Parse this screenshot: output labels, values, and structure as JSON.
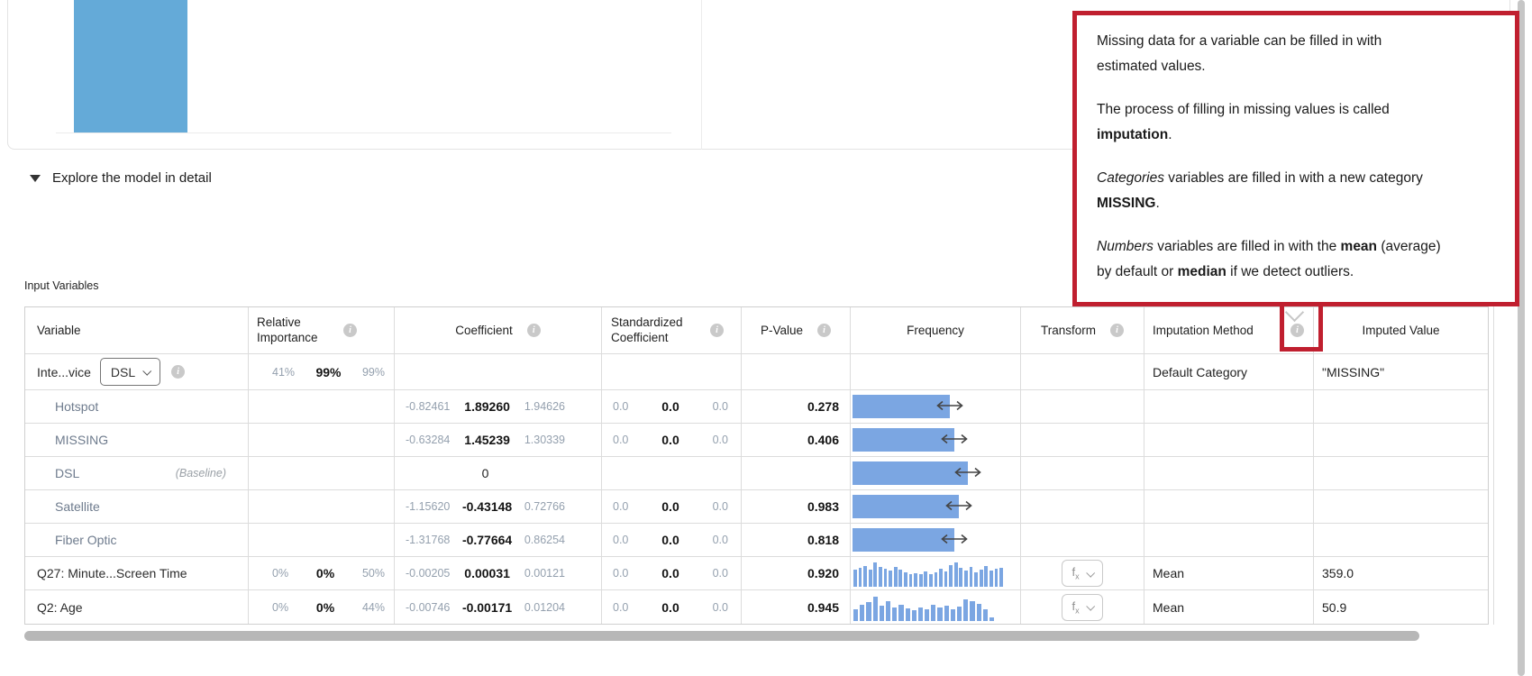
{
  "colors": {
    "chart_bar": "#64aad8",
    "freq_bar": "#7ba6e2",
    "annotation_red": "#c01f2f"
  },
  "explore": {
    "label": "Explore the model in detail"
  },
  "table": {
    "section_label": "Input Variables",
    "columns": [
      {
        "key": "variable",
        "label": "Variable",
        "info": false
      },
      {
        "key": "rel",
        "label": "Relative Importance",
        "info": true
      },
      {
        "key": "coef",
        "label": "Coefficient",
        "info": true
      },
      {
        "key": "std",
        "label": "Standardized Coefficient",
        "info": true
      },
      {
        "key": "pval",
        "label": "P-Value",
        "info": true
      },
      {
        "key": "freq",
        "label": "Frequency",
        "info": false
      },
      {
        "key": "transform",
        "label": "Transform",
        "info": true
      },
      {
        "key": "imp_method",
        "label": "Imputation Method",
        "info": true
      },
      {
        "key": "imp_value",
        "label": "Imputed Value",
        "info": false
      }
    ],
    "rows": [
      {
        "type": "parent",
        "label": "Inte...vice",
        "dropdown_value": "DSL",
        "rel": [
          "41%",
          "99%",
          "99%"
        ],
        "imp_method": "Default Category",
        "imp_value": "\"MISSING\""
      },
      {
        "type": "category",
        "label": "Hotspot",
        "coef": [
          "-0.82461",
          "1.89260",
          "1.94626"
        ],
        "std": [
          "0.0",
          "0.0",
          "0.0"
        ],
        "pval": "0.278",
        "bar": 108
      },
      {
        "type": "category",
        "label": "MISSING",
        "coef": [
          "-0.63284",
          "1.45239",
          "1.30339"
        ],
        "std": [
          "0.0",
          "0.0",
          "0.0"
        ],
        "pval": "0.406",
        "bar": 113
      },
      {
        "type": "category",
        "label": "DSL",
        "note": "(Baseline)",
        "coef_single": "0",
        "bar": 128
      },
      {
        "type": "category",
        "label": "Satellite",
        "coef": [
          "-1.15620",
          "-0.43148",
          "0.72766"
        ],
        "std": [
          "0.0",
          "0.0",
          "0.0"
        ],
        "pval": "0.983",
        "bar": 118
      },
      {
        "type": "category",
        "label": "Fiber Optic",
        "coef": [
          "-1.31768",
          "-0.77664",
          "0.86254"
        ],
        "std": [
          "0.0",
          "0.0",
          "0.0"
        ],
        "pval": "0.818",
        "bar": 113
      },
      {
        "type": "numeric",
        "label": "Q27: Minute...Screen Time",
        "rel": [
          "0%",
          "0%",
          "50%"
        ],
        "coef": [
          "-0.00205",
          "0.00031",
          "0.00121"
        ],
        "std": [
          "0.0",
          "0.0",
          "0.0"
        ],
        "pval": "0.920",
        "hist": [
          19,
          21,
          23,
          19,
          27,
          22,
          20,
          18,
          22,
          19,
          16,
          14,
          15,
          14,
          17,
          14,
          16,
          20,
          17,
          24,
          27,
          21,
          18,
          22,
          16,
          19,
          23,
          18,
          20,
          21
        ],
        "transform": "fx",
        "imp_method": "Mean",
        "imp_value": "359.0"
      },
      {
        "type": "numeric",
        "label": "Q2: Age",
        "rel": [
          "0%",
          "0%",
          "44%"
        ],
        "coef": [
          "-0.00746",
          "-0.00171",
          "0.01204"
        ],
        "std": [
          "0.0",
          "0.0",
          "0.0"
        ],
        "pval": "0.945",
        "hist": [
          13,
          18,
          21,
          27,
          17,
          22,
          15,
          18,
          14,
          12,
          15,
          13,
          18,
          15,
          17,
          13,
          16,
          24,
          22,
          19,
          13,
          4
        ],
        "transform": "fx",
        "imp_method": "Mean",
        "imp_value": "50.9"
      }
    ]
  },
  "tooltip": {
    "paragraphs": [
      {
        "lines": [
          [
            {
              "t": "Missing data for a variable can be filled in with"
            }
          ],
          [
            {
              "t": "estimated values."
            }
          ]
        ]
      },
      {
        "lines": [
          [
            {
              "t": "The process of filling in missing values is called"
            }
          ],
          [
            {
              "t": "imputation",
              "b": true
            },
            {
              "t": "."
            }
          ]
        ]
      },
      {
        "lines": [
          [
            {
              "t": "Categories",
              "i": true
            },
            {
              "t": " variables are filled in with a new category"
            }
          ],
          [
            {
              "t": "MISSING",
              "b": true
            },
            {
              "t": "."
            }
          ]
        ]
      },
      {
        "lines": [
          [
            {
              "t": "Numbers",
              "i": true
            },
            {
              "t": " variables are filled in with the "
            },
            {
              "t": "mean",
              "b": true
            },
            {
              "t": " (average)"
            }
          ],
          [
            {
              "t": "by default or "
            },
            {
              "t": "median",
              "b": true
            },
            {
              "t": " if we detect outliers."
            }
          ]
        ]
      }
    ]
  }
}
